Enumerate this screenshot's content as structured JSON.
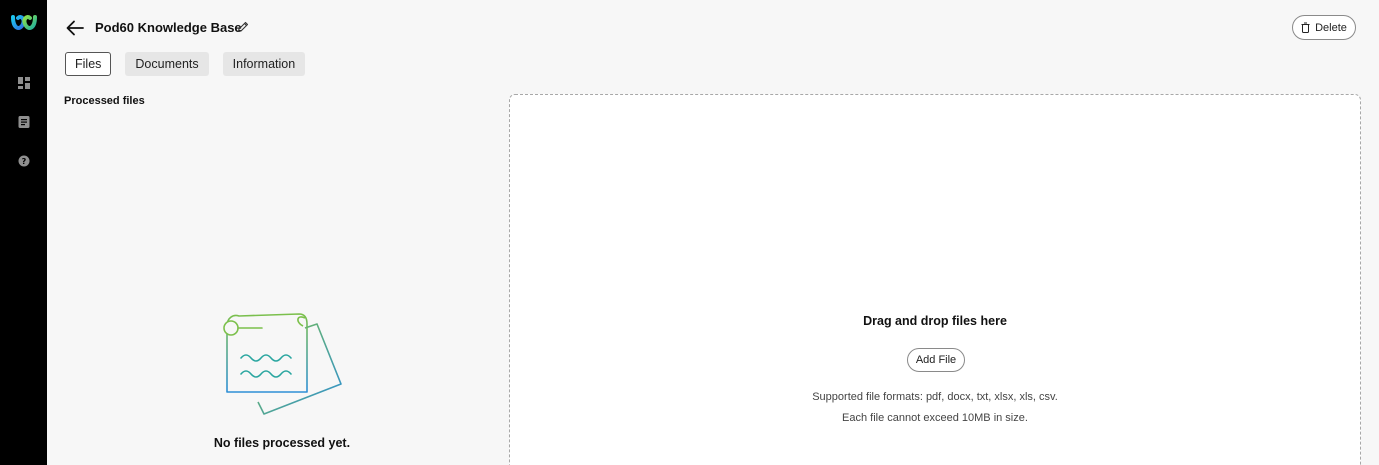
{
  "app": {
    "logo": "webex-logo"
  },
  "sidebar": {
    "items": [
      {
        "icon": "dashboard-icon"
      },
      {
        "icon": "document-icon"
      },
      {
        "icon": "help-icon"
      }
    ]
  },
  "header": {
    "title": "Pod60 Knowledge Base",
    "delete_label": "Delete"
  },
  "tabs": [
    {
      "label": "Files",
      "active": true
    },
    {
      "label": "Documents",
      "active": false
    },
    {
      "label": "Information",
      "active": false
    }
  ],
  "processed": {
    "label": "Processed files",
    "empty_text": "No files processed yet."
  },
  "dropzone": {
    "title": "Drag and drop files here",
    "add_file_label": "Add File",
    "formats_note": "Supported file formats: pdf, docx, txt, xlsx, xls, csv.",
    "size_note": "Each file cannot exceed 10MB in size."
  },
  "colors": {
    "illus_green": "#7cc04b",
    "illus_teal": "#2aa6a0",
    "illus_blue": "#2d8fd6"
  }
}
